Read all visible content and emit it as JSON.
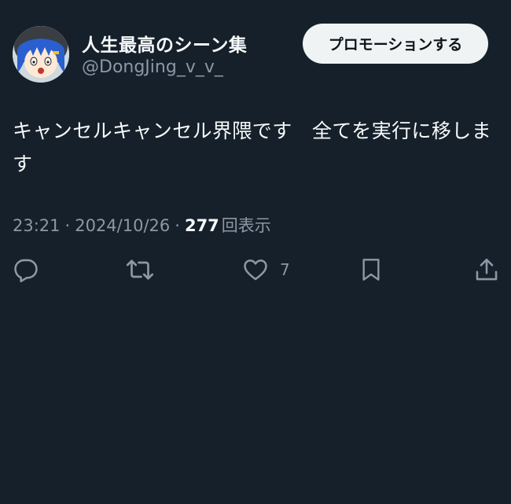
{
  "user": {
    "display_name": "人生最高のシーン集",
    "handle": "@DongJing_v_v_"
  },
  "promote_button": {
    "label": "プロモーションする"
  },
  "tweet": {
    "text": "キャンセルキャンセル界隈です　全てを実行に移します"
  },
  "meta": {
    "time": "23:21",
    "separator": "·",
    "date": "2024/10/26",
    "views_count": "277",
    "views_label": "回表示"
  },
  "actions": {
    "like_count": "7"
  },
  "icons": {
    "reply": "reply-icon",
    "retweet": "retweet-icon",
    "like": "heart-icon",
    "bookmark": "bookmark-icon",
    "share": "share-icon"
  },
  "colors": {
    "background": "#15202b",
    "primary_text": "#f7f9f9",
    "secondary_text": "#8b98a5",
    "button_bg": "#eff3f4",
    "button_text": "#0f1419"
  }
}
